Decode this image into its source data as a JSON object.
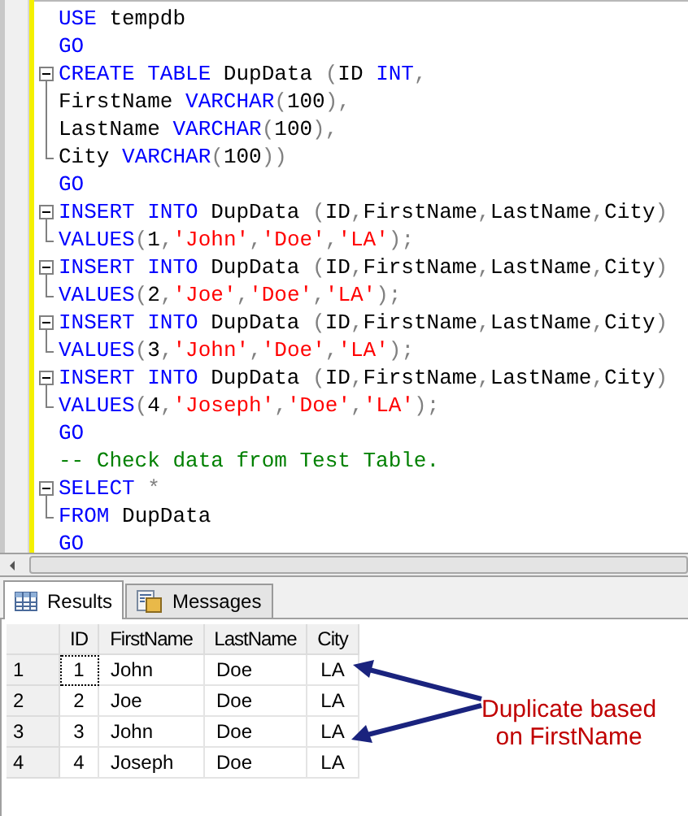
{
  "editor": {
    "lines": [
      {
        "kind": "plain",
        "tokens": [
          {
            "kind": "kw",
            "text": "USE"
          },
          {
            "kind": "id",
            "text": " tempdb"
          }
        ]
      },
      {
        "kind": "plain",
        "tokens": [
          {
            "kind": "kw",
            "text": "GO"
          }
        ]
      },
      {
        "kind": "open",
        "tokens": [
          {
            "kind": "kw",
            "text": "CREATE TABLE"
          },
          {
            "kind": "id",
            "text": " DupData "
          },
          {
            "kind": "op",
            "text": "("
          },
          {
            "kind": "id",
            "text": "ID "
          },
          {
            "kind": "kw",
            "text": "INT"
          },
          {
            "kind": "op",
            "text": ","
          }
        ]
      },
      {
        "kind": "mid",
        "tokens": [
          {
            "kind": "id",
            "text": "FirstName "
          },
          {
            "kind": "kw",
            "text": "VARCHAR"
          },
          {
            "kind": "op",
            "text": "("
          },
          {
            "kind": "id",
            "text": "100"
          },
          {
            "kind": "op",
            "text": "),"
          }
        ]
      },
      {
        "kind": "mid",
        "tokens": [
          {
            "kind": "id",
            "text": "LastName "
          },
          {
            "kind": "kw",
            "text": "VARCHAR"
          },
          {
            "kind": "op",
            "text": "("
          },
          {
            "kind": "id",
            "text": "100"
          },
          {
            "kind": "op",
            "text": "),"
          }
        ]
      },
      {
        "kind": "end",
        "tokens": [
          {
            "kind": "id",
            "text": "City "
          },
          {
            "kind": "kw",
            "text": "VARCHAR"
          },
          {
            "kind": "op",
            "text": "("
          },
          {
            "kind": "id",
            "text": "100"
          },
          {
            "kind": "op",
            "text": "))"
          }
        ]
      },
      {
        "kind": "plain",
        "tokens": [
          {
            "kind": "kw",
            "text": "GO"
          }
        ]
      },
      {
        "kind": "open",
        "tokens": [
          {
            "kind": "kw",
            "text": "INSERT INTO"
          },
          {
            "kind": "id",
            "text": " DupData "
          },
          {
            "kind": "op",
            "text": "("
          },
          {
            "kind": "id",
            "text": "ID"
          },
          {
            "kind": "op",
            "text": ","
          },
          {
            "kind": "id",
            "text": "FirstName"
          },
          {
            "kind": "op",
            "text": ","
          },
          {
            "kind": "id",
            "text": "LastName"
          },
          {
            "kind": "op",
            "text": ","
          },
          {
            "kind": "id",
            "text": "City"
          },
          {
            "kind": "op",
            "text": ")"
          }
        ]
      },
      {
        "kind": "end",
        "tokens": [
          {
            "kind": "kw",
            "text": "VALUES"
          },
          {
            "kind": "op",
            "text": "("
          },
          {
            "kind": "id",
            "text": "1"
          },
          {
            "kind": "op",
            "text": ","
          },
          {
            "kind": "str",
            "text": "'John'"
          },
          {
            "kind": "op",
            "text": ","
          },
          {
            "kind": "str",
            "text": "'Doe'"
          },
          {
            "kind": "op",
            "text": ","
          },
          {
            "kind": "str",
            "text": "'LA'"
          },
          {
            "kind": "op",
            "text": ");"
          }
        ]
      },
      {
        "kind": "open",
        "tokens": [
          {
            "kind": "kw",
            "text": "INSERT INTO"
          },
          {
            "kind": "id",
            "text": " DupData "
          },
          {
            "kind": "op",
            "text": "("
          },
          {
            "kind": "id",
            "text": "ID"
          },
          {
            "kind": "op",
            "text": ","
          },
          {
            "kind": "id",
            "text": "FirstName"
          },
          {
            "kind": "op",
            "text": ","
          },
          {
            "kind": "id",
            "text": "LastName"
          },
          {
            "kind": "op",
            "text": ","
          },
          {
            "kind": "id",
            "text": "City"
          },
          {
            "kind": "op",
            "text": ")"
          }
        ]
      },
      {
        "kind": "end",
        "tokens": [
          {
            "kind": "kw",
            "text": "VALUES"
          },
          {
            "kind": "op",
            "text": "("
          },
          {
            "kind": "id",
            "text": "2"
          },
          {
            "kind": "op",
            "text": ","
          },
          {
            "kind": "str",
            "text": "'Joe'"
          },
          {
            "kind": "op",
            "text": ","
          },
          {
            "kind": "str",
            "text": "'Doe'"
          },
          {
            "kind": "op",
            "text": ","
          },
          {
            "kind": "str",
            "text": "'LA'"
          },
          {
            "kind": "op",
            "text": ");"
          }
        ]
      },
      {
        "kind": "open",
        "tokens": [
          {
            "kind": "kw",
            "text": "INSERT INTO"
          },
          {
            "kind": "id",
            "text": " DupData "
          },
          {
            "kind": "op",
            "text": "("
          },
          {
            "kind": "id",
            "text": "ID"
          },
          {
            "kind": "op",
            "text": ","
          },
          {
            "kind": "id",
            "text": "FirstName"
          },
          {
            "kind": "op",
            "text": ","
          },
          {
            "kind": "id",
            "text": "LastName"
          },
          {
            "kind": "op",
            "text": ","
          },
          {
            "kind": "id",
            "text": "City"
          },
          {
            "kind": "op",
            "text": ")"
          }
        ]
      },
      {
        "kind": "end",
        "tokens": [
          {
            "kind": "kw",
            "text": "VALUES"
          },
          {
            "kind": "op",
            "text": "("
          },
          {
            "kind": "id",
            "text": "3"
          },
          {
            "kind": "op",
            "text": ","
          },
          {
            "kind": "str",
            "text": "'John'"
          },
          {
            "kind": "op",
            "text": ","
          },
          {
            "kind": "str",
            "text": "'Doe'"
          },
          {
            "kind": "op",
            "text": ","
          },
          {
            "kind": "str",
            "text": "'LA'"
          },
          {
            "kind": "op",
            "text": ");"
          }
        ]
      },
      {
        "kind": "open",
        "tokens": [
          {
            "kind": "kw",
            "text": "INSERT INTO"
          },
          {
            "kind": "id",
            "text": " DupData "
          },
          {
            "kind": "op",
            "text": "("
          },
          {
            "kind": "id",
            "text": "ID"
          },
          {
            "kind": "op",
            "text": ","
          },
          {
            "kind": "id",
            "text": "FirstName"
          },
          {
            "kind": "op",
            "text": ","
          },
          {
            "kind": "id",
            "text": "LastName"
          },
          {
            "kind": "op",
            "text": ","
          },
          {
            "kind": "id",
            "text": "City"
          },
          {
            "kind": "op",
            "text": ")"
          }
        ]
      },
      {
        "kind": "end",
        "tokens": [
          {
            "kind": "kw",
            "text": "VALUES"
          },
          {
            "kind": "op",
            "text": "("
          },
          {
            "kind": "id",
            "text": "4"
          },
          {
            "kind": "op",
            "text": ","
          },
          {
            "kind": "str",
            "text": "'Joseph'"
          },
          {
            "kind": "op",
            "text": ","
          },
          {
            "kind": "str",
            "text": "'Doe'"
          },
          {
            "kind": "op",
            "text": ","
          },
          {
            "kind": "str",
            "text": "'LA'"
          },
          {
            "kind": "op",
            "text": ");"
          }
        ]
      },
      {
        "kind": "plain",
        "tokens": [
          {
            "kind": "kw",
            "text": "GO"
          }
        ]
      },
      {
        "kind": "plain",
        "tokens": [
          {
            "kind": "comment",
            "text": "-- Check data from Test Table."
          }
        ]
      },
      {
        "kind": "open",
        "tokens": [
          {
            "kind": "kw",
            "text": "SELECT "
          },
          {
            "kind": "op",
            "text": "*"
          }
        ]
      },
      {
        "kind": "end",
        "tokens": [
          {
            "kind": "kw",
            "text": "FROM"
          },
          {
            "kind": "id",
            "text": " DupData"
          }
        ]
      },
      {
        "kind": "plain",
        "tokens": [
          {
            "kind": "kw",
            "text": "GO"
          }
        ]
      }
    ]
  },
  "tabs": [
    {
      "label": "Results",
      "kind": "grid",
      "selected": true
    },
    {
      "label": "Messages",
      "kind": "messages",
      "selected": false
    }
  ],
  "results": {
    "columns": [
      "ID",
      "FirstName",
      "LastName",
      "City"
    ],
    "rows": [
      {
        "number": "1",
        "selected": true,
        "cells": [
          "1",
          "John",
          "Doe",
          "LA"
        ]
      },
      {
        "number": "2",
        "selected": false,
        "cells": [
          "2",
          "Joe",
          "Doe",
          "LA"
        ]
      },
      {
        "number": "3",
        "selected": false,
        "cells": [
          "3",
          "John",
          "Doe",
          "LA"
        ]
      },
      {
        "number": "4",
        "selected": false,
        "cells": [
          "4",
          "Joseph",
          "Doe",
          "LA"
        ]
      }
    ]
  },
  "annotation": {
    "lines": [
      "Duplicate based",
      "on FirstName"
    ]
  }
}
